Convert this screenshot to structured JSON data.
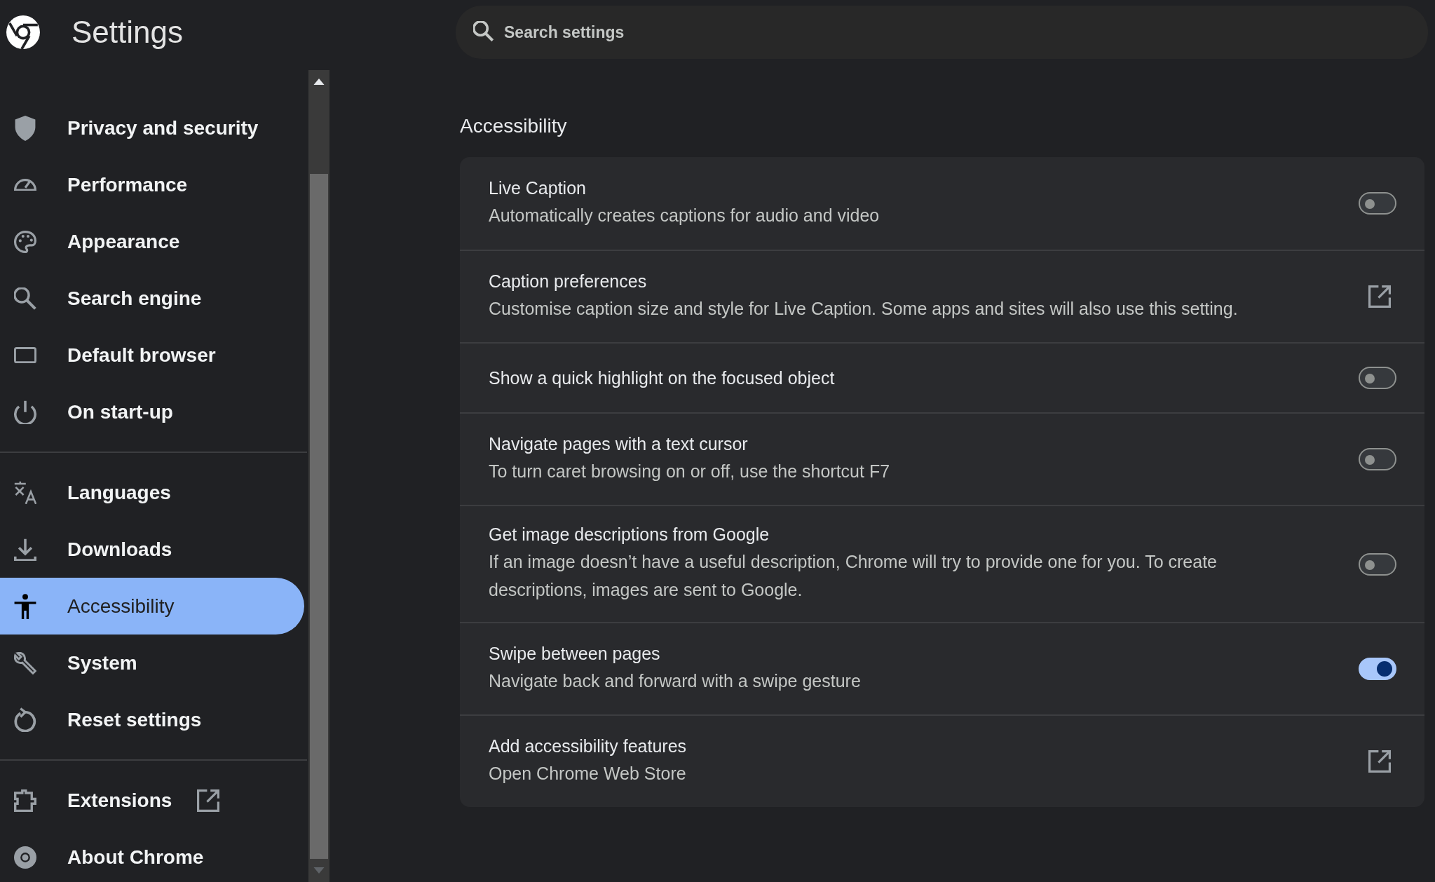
{
  "header": {
    "title": "Settings",
    "search": {
      "placeholder": "Search settings"
    }
  },
  "sidebar": {
    "items": [
      {
        "label": "Privacy and security",
        "selected": false
      },
      {
        "label": "Performance",
        "selected": false
      },
      {
        "label": "Appearance",
        "selected": false
      },
      {
        "label": "Search engine",
        "selected": false
      },
      {
        "label": "Default browser",
        "selected": false
      },
      {
        "label": "On start-up",
        "selected": false
      },
      {
        "label": "Languages",
        "selected": false
      },
      {
        "label": "Downloads",
        "selected": false
      },
      {
        "label": "Accessibility",
        "selected": true
      },
      {
        "label": "System",
        "selected": false
      },
      {
        "label": "Reset settings",
        "selected": false
      },
      {
        "label": "Extensions",
        "selected": false,
        "external": true
      },
      {
        "label": "About Chrome",
        "selected": false
      }
    ]
  },
  "section": {
    "heading": "Accessibility",
    "rows": [
      {
        "kind": "toggle",
        "title": "Live Caption",
        "description": "Automatically creates captions for audio and video",
        "on": false
      },
      {
        "kind": "link",
        "title": "Caption preferences",
        "description": "Customise caption size and style for Live Caption. Some apps and sites will also use this setting."
      },
      {
        "kind": "toggle",
        "title": "Show a quick highlight on the focused object",
        "on": false
      },
      {
        "kind": "toggle",
        "title": "Navigate pages with a text cursor",
        "description": "To turn caret browsing on or off, use the shortcut F7",
        "on": false
      },
      {
        "kind": "toggle",
        "title": "Get image descriptions from Google",
        "description": "If an image doesn’t have a useful description, Chrome will try to provide one for you. To create descriptions, images are sent to Google.",
        "on": false
      },
      {
        "kind": "toggle",
        "title": "Swipe between pages",
        "description": "Navigate back and forward with a swipe gesture",
        "on": true
      },
      {
        "kind": "link",
        "title": "Add accessibility features",
        "description": "Open Chrome Web Store"
      }
    ]
  }
}
